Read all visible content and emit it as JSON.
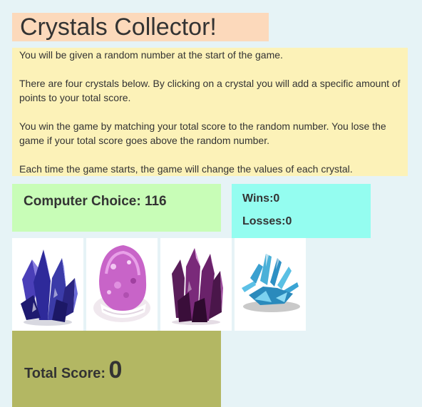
{
  "title": "Crystals Collector!",
  "instructions": [
    "You will be given a random number at the start of the game.",
    "There are four crystals below. By clicking on a crystal you will add a specific amount of points to your total score.",
    "You win the game by matching your total score to the random number. You lose the game if your total score goes above the random number.",
    "Each time the game starts, the game will change the values of each crystal."
  ],
  "computer_choice": {
    "label": "Computer Choice:",
    "value": "116"
  },
  "scoreboard": {
    "wins_label": "Wins:",
    "wins_value": "0",
    "losses_label": "Losses:",
    "losses_value": "0"
  },
  "crystals": [
    {
      "name": "blue-purple crystal cluster",
      "color": "#3b3ba8"
    },
    {
      "name": "pink amethyst geode",
      "color": "#c864c8"
    },
    {
      "name": "dark purple crystal cluster",
      "color": "#7a2a7a"
    },
    {
      "name": "light blue crystal cluster",
      "color": "#4ab0d8"
    }
  ],
  "total_score": {
    "label": "Total Score:",
    "value": "0"
  },
  "colors": {
    "background": "#e6f3f6",
    "title_bg": "#fcd9bb",
    "instructions_bg": "#fcf2b8",
    "computer_choice_bg": "#c8fdb7",
    "scoreboard_bg": "#94fdf0",
    "total_bg": "#b3b763"
  }
}
